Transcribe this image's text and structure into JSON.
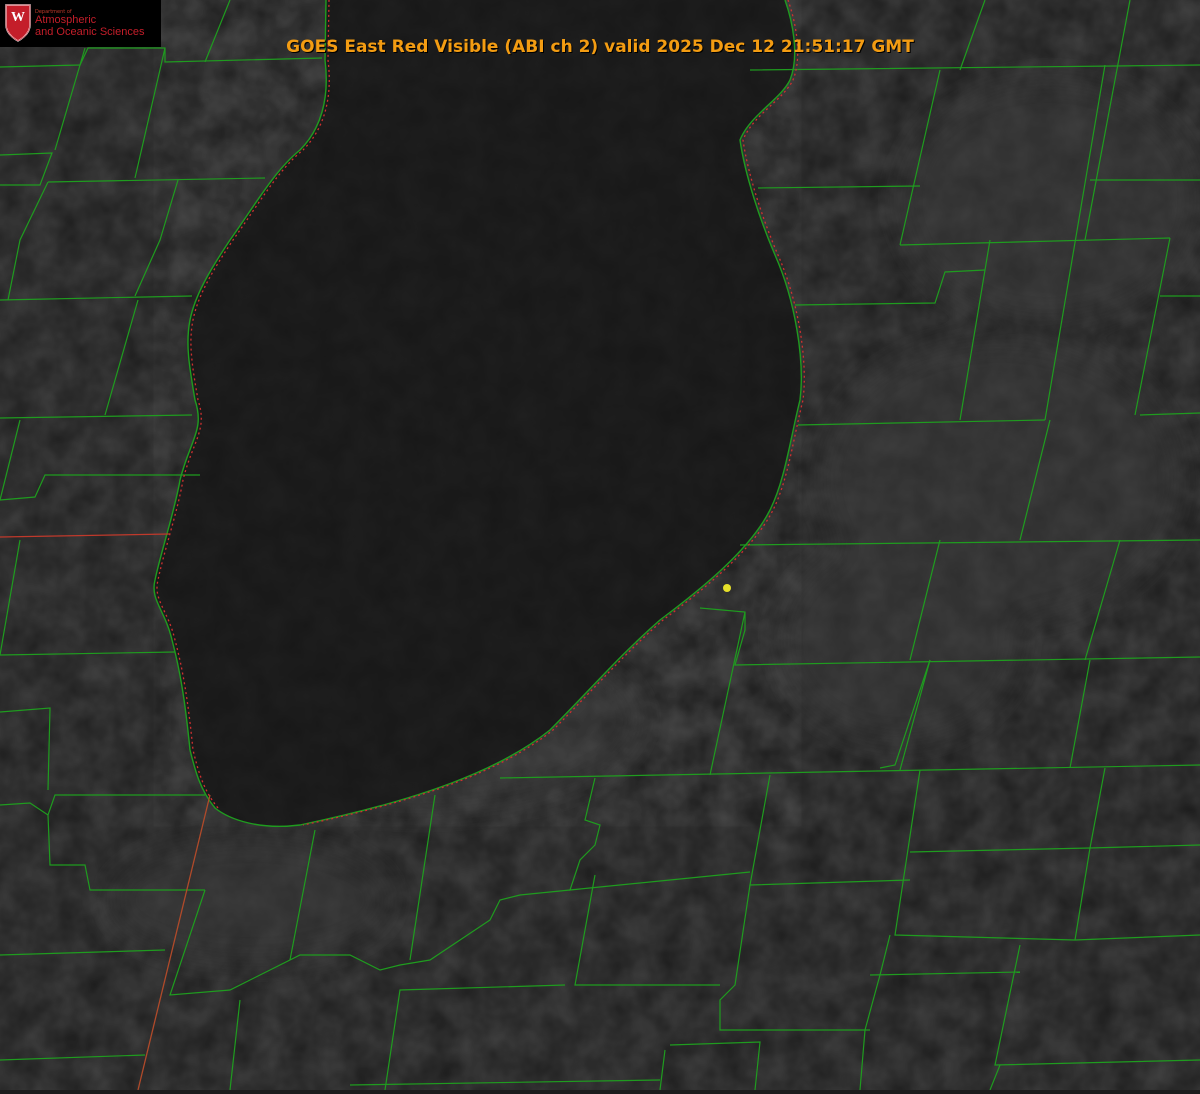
{
  "title": "GOES East Red Visible (ABI ch 2) valid 2025 Dec 12 21:51:17 GMT",
  "logo": {
    "department": "Department of",
    "line1": "Atmospheric",
    "line2": "and Oceanic Sciences",
    "shield_letter": "W"
  },
  "colors": {
    "background": "#1c1c1c",
    "lake": "#181818",
    "county_lines": "#1f9c1f",
    "state_line": "#c0392b",
    "title": "#f39c12",
    "marker": "#e6e02a",
    "logo_red": "#c41e2a"
  },
  "layers": [
    "visible-satellite-imagery",
    "county-boundaries",
    "state-boundaries",
    "lake-michigan-shoreline",
    "location-marker"
  ]
}
